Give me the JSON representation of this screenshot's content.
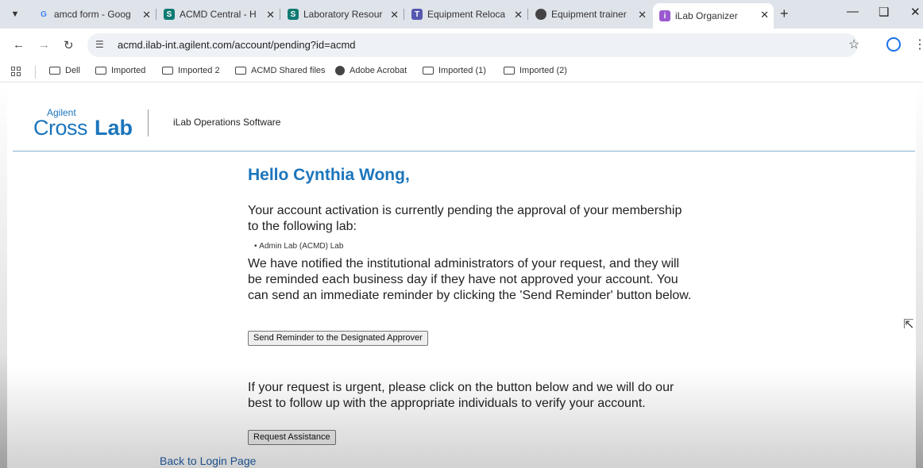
{
  "browser": {
    "tabs": [
      {
        "title": "amcd form - Goog",
        "favicon": "G",
        "color": "#4285f4",
        "active": false
      },
      {
        "title": "ACMD Central - H",
        "favicon": "sharepoint-icon",
        "color": "#0f7b73",
        "active": false
      },
      {
        "title": "Laboratory Resour",
        "favicon": "sharepoint-icon",
        "color": "#0f7b73",
        "active": false
      },
      {
        "title": "Equipment Reloca",
        "favicon": "teams-icon",
        "color": "#5558af",
        "active": false
      },
      {
        "title": "Equipment trainer",
        "favicon": "globe-icon",
        "color": "#444444",
        "active": false
      },
      {
        "title": "iLab Organizer",
        "favicon": "ilab-icon",
        "color": "#9b59d0",
        "active": true
      }
    ],
    "url": "acmd.ilab-int.agilent.com/account/pending?id=acmd",
    "bookmarks": [
      {
        "label": "Dell",
        "icon": "folder-icon"
      },
      {
        "label": "Imported",
        "icon": "folder-icon"
      },
      {
        "label": "Imported 2",
        "icon": "folder-icon"
      },
      {
        "label": "ACMD Shared files",
        "icon": "folder-icon"
      },
      {
        "label": "Adobe Acrobat",
        "icon": "globe-icon"
      },
      {
        "label": "Imported (1)",
        "icon": "folder-icon"
      },
      {
        "label": "Imported (2)",
        "icon": "folder-icon"
      }
    ]
  },
  "header": {
    "logo_small": "Agilent",
    "logo_cross": "Cross",
    "logo_lab": "Lab",
    "product": "iLab Operations Software"
  },
  "main": {
    "greeting": "Hello Cynthia Wong,",
    "pending_text": "Your account activation is currently pending the approval of your membership to the following lab:",
    "labs": [
      "Admin Lab (ACMD) Lab"
    ],
    "notified_text": "We have notified the institutional administrators of your request, and they will be reminded each business day if they have not approved your account. You can send an immediate reminder by clicking the 'Send Reminder' button below.",
    "reminder_button": "Send Reminder to the Designated Approver",
    "urgent_text": "If your request is urgent, please click on the button below and we will do our best to follow up with the appropriate individuals to verify your account.",
    "assist_button": "Request Assistance",
    "back_link": "Back to Login Page"
  },
  "colors": {
    "brand": "#1b75bc",
    "link": "#1b4f8a"
  }
}
